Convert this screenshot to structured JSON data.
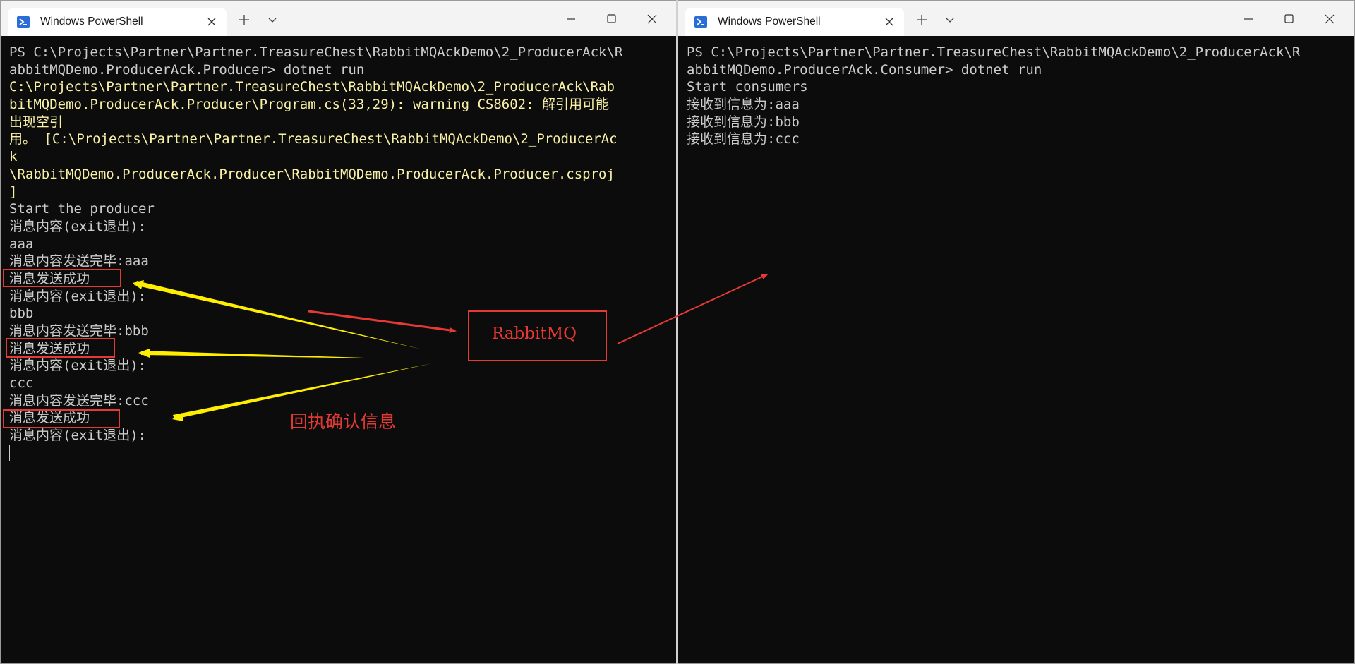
{
  "left_window": {
    "tab_title": "Windows PowerShell",
    "terminal_lines": [
      {
        "text": "PS C:\\Projects\\Partner\\Partner.TreasureChest\\RabbitMQAckDemo\\2_ProducerAck\\R",
        "style": "normal"
      },
      {
        "text": "abbitMQDemo.ProducerAck.Producer> dotnet run",
        "style": "normal"
      },
      {
        "text": "C:\\Projects\\Partner\\Partner.TreasureChest\\RabbitMQAckDemo\\2_ProducerAck\\Rab",
        "style": "warn"
      },
      {
        "text": "bitMQDemo.ProducerAck.Producer\\Program.cs(33,29): warning CS8602: 解引用可能",
        "style": "warn"
      },
      {
        "text": "出现空引",
        "style": "warn"
      },
      {
        "text": "用。 [C:\\Projects\\Partner\\Partner.TreasureChest\\RabbitMQAckDemo\\2_ProducerAc",
        "style": "warn"
      },
      {
        "text": "k",
        "style": "warn"
      },
      {
        "text": "\\RabbitMQDemo.ProducerAck.Producer\\RabbitMQDemo.ProducerAck.Producer.csproj",
        "style": "warn"
      },
      {
        "text": "]",
        "style": "warn"
      },
      {
        "text": "Start the producer",
        "style": "normal"
      },
      {
        "text": "消息内容(exit退出):",
        "style": "normal"
      },
      {
        "text": "aaa",
        "style": "normal"
      },
      {
        "text": "消息内容发送完毕:aaa",
        "style": "normal"
      },
      {
        "text": "消息发送成功",
        "style": "normal"
      },
      {
        "text": "消息内容(exit退出):",
        "style": "normal"
      },
      {
        "text": "bbb",
        "style": "normal"
      },
      {
        "text": "消息内容发送完毕:bbb",
        "style": "normal"
      },
      {
        "text": "消息发送成功",
        "style": "normal"
      },
      {
        "text": "消息内容(exit退出):",
        "style": "normal"
      },
      {
        "text": "ccc",
        "style": "normal"
      },
      {
        "text": "消息内容发送完毕:ccc",
        "style": "normal"
      },
      {
        "text": "消息发送成功",
        "style": "normal"
      },
      {
        "text": "消息内容(exit退出):",
        "style": "normal"
      }
    ]
  },
  "right_window": {
    "tab_title": "Windows PowerShell",
    "terminal_lines": [
      {
        "text": "PS C:\\Projects\\Partner\\Partner.TreasureChest\\RabbitMQAckDemo\\2_ProducerAck\\R",
        "style": "normal"
      },
      {
        "text": "abbitMQDemo.ProducerAck.Consumer> dotnet run",
        "style": "normal"
      },
      {
        "text": "Start consumers",
        "style": "normal"
      },
      {
        "text": "接收到信息为:aaa",
        "style": "normal"
      },
      {
        "text": "接收到信息为:bbb",
        "style": "normal"
      },
      {
        "text": "接收到信息为:ccc",
        "style": "normal"
      }
    ]
  },
  "annotations": {
    "rabbitmq_label": "RabbitMQ",
    "ack_label": "回执确认信息"
  },
  "colors": {
    "terminal_bg": "#0c0c0c",
    "terminal_text": "#cccccc",
    "warning_text": "#f9f1a5",
    "annotation_red": "#e53935",
    "annotation_yellow": "#ffee00"
  }
}
